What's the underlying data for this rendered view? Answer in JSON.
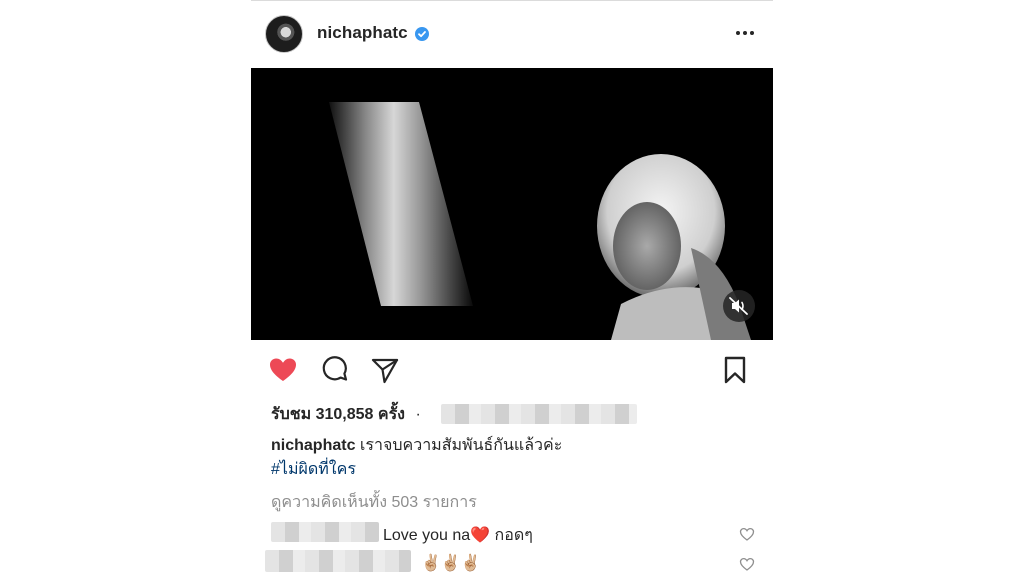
{
  "post": {
    "username": "nichaphatc",
    "views_text": "รับชม 310,858 ครั้ง",
    "separator": "·",
    "caption_text": "เราจบความสัมพันธ์กันแล้วค่ะ",
    "hashtag": "#ไม่ผิดที่ใคร",
    "view_all_comments": "ดูความคิดเห็นทั้ง 503 รายการ"
  },
  "comments": [
    {
      "text_before": "Love you na",
      "emoji": "❤️",
      "text_after": " กอดๆ"
    },
    {
      "text": "✌🏼✌🏼✌🏼"
    }
  ],
  "icons": {
    "verified": "verified-badge-icon",
    "more": "more-options-icon",
    "like": "heart-icon",
    "comment": "comment-icon",
    "share": "share-icon",
    "save": "bookmark-icon",
    "mute": "muted-speaker-icon"
  },
  "colors": {
    "like_active": "#ed4956",
    "verified": "#3897f0",
    "hashtag": "#00376b",
    "secondary_text": "#8e8e8e"
  }
}
